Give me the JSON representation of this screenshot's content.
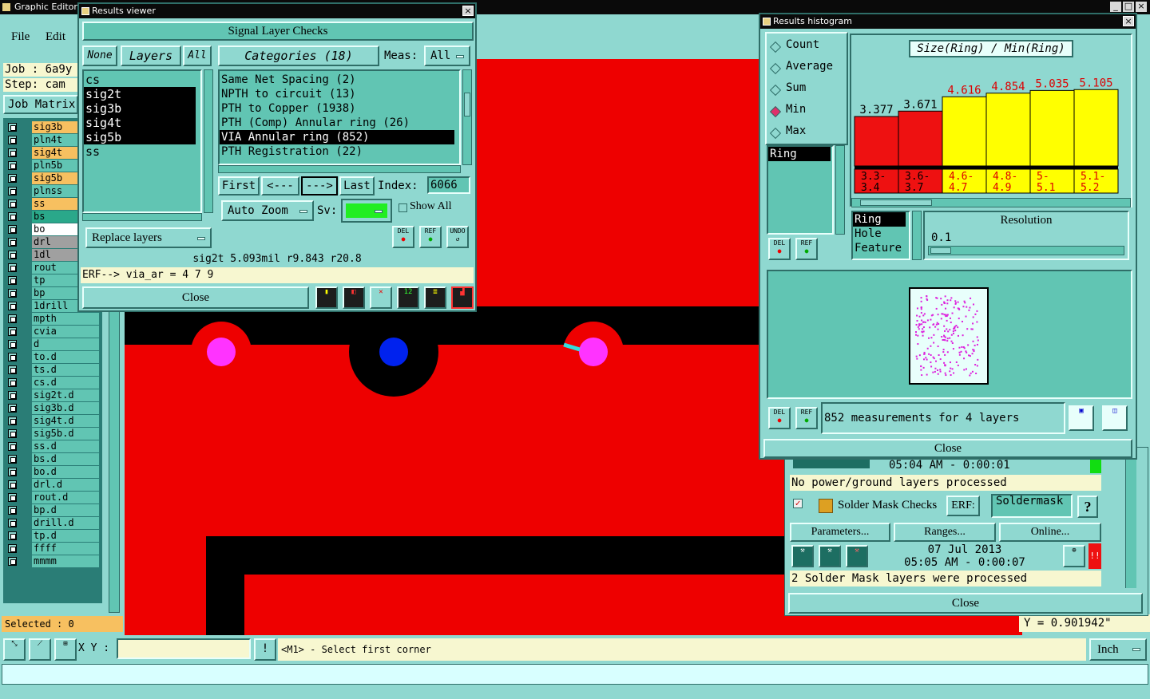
{
  "main": {
    "title": "Graphic Editor",
    "menu": [
      "File",
      "Edit"
    ],
    "job_label": "Job : 6a9y",
    "step_label": "Step: cam",
    "job_matrix": "Job Matrix",
    "selected": "Selected : 0",
    "xy_label": "X Y :",
    "status_msg": "<M1> - Select first corner",
    "units": "Inch",
    "y_readout": "Y = 0.901942\"",
    "bang": "!"
  },
  "layers": [
    {
      "name": "sig3b",
      "color": "#f7c060"
    },
    {
      "name": "pln4t",
      "color": "#61c5b3"
    },
    {
      "name": "sig4t",
      "color": "#f7c060"
    },
    {
      "name": "pln5b",
      "color": "#61c5b3"
    },
    {
      "name": "sig5b",
      "color": "#f7c060"
    },
    {
      "name": "plnss",
      "color": "#61c5b3"
    },
    {
      "name": "ss",
      "color": "#f7c060"
    },
    {
      "name": "bs",
      "color": "#2aa88a"
    },
    {
      "name": "bo",
      "color": "#ffffff"
    },
    {
      "name": "drl",
      "color": "#a0a0a0"
    },
    {
      "name": "1dl",
      "color": "#a0a0a0"
    },
    {
      "name": "rout",
      "color": "#61c5b3"
    },
    {
      "name": "tp",
      "color": "#61c5b3"
    },
    {
      "name": "bp",
      "color": "#61c5b3"
    },
    {
      "name": "1drill",
      "color": "#61c5b3"
    },
    {
      "name": "mpth",
      "color": "#61c5b3"
    },
    {
      "name": "cvia",
      "color": "#61c5b3"
    },
    {
      "name": "d",
      "color": "#61c5b3"
    },
    {
      "name": "to.d",
      "color": "#61c5b3"
    },
    {
      "name": "ts.d",
      "color": "#61c5b3"
    },
    {
      "name": "cs.d",
      "color": "#61c5b3"
    },
    {
      "name": "sig2t.d",
      "color": "#61c5b3"
    },
    {
      "name": "sig3b.d",
      "color": "#61c5b3"
    },
    {
      "name": "sig4t.d",
      "color": "#61c5b3"
    },
    {
      "name": "sig5b.d",
      "color": "#61c5b3"
    },
    {
      "name": "ss.d",
      "color": "#61c5b3"
    },
    {
      "name": "bs.d",
      "color": "#61c5b3"
    },
    {
      "name": "bo.d",
      "color": "#61c5b3"
    },
    {
      "name": "drl.d",
      "color": "#61c5b3"
    },
    {
      "name": "rout.d",
      "color": "#61c5b3"
    },
    {
      "name": "bp.d",
      "color": "#61c5b3"
    },
    {
      "name": "drill.d",
      "color": "#61c5b3"
    },
    {
      "name": "tp.d",
      "color": "#61c5b3"
    },
    {
      "name": "ffff",
      "color": "#61c5b3"
    },
    {
      "name": "mmmm",
      "color": "#61c5b3"
    }
  ],
  "viewer": {
    "title": "Results viewer",
    "header": "Signal Layer Checks",
    "btn_none": "None",
    "btn_layers": "Layers",
    "btn_all": "All",
    "layer_list": [
      "cs",
      "sig2t",
      "sig3b",
      "sig4t",
      "sig5b",
      "ss"
    ],
    "categories_label": "Categories (18)",
    "meas_label": "Meas:",
    "meas_value": "All",
    "categories": [
      "Same Net Spacing (2)",
      "NPTH to circuit (13)",
      "PTH to Copper (1938)",
      "PTH (Comp) Annular ring (26)",
      "VIA Annular ring (852)",
      "PTH Registration (22)"
    ],
    "first": "First",
    "prev": "<---",
    "next": "--->",
    "last": "Last",
    "index_label": "Index:",
    "index_value": "6066",
    "auto_zoom": "Auto Zoom",
    "sv_label": "Sv:",
    "show_all": "Show All",
    "replace_layers": "Replace layers",
    "del": "DEL",
    "ref": "REF",
    "undo": "UNDO",
    "status": "sig2t 5.093mil r9.843 r20.8",
    "erf": "ERF--> via_ar = 4 7 9",
    "close": "Close"
  },
  "histogram": {
    "title": "Results histogram",
    "radio": [
      "Count",
      "Average",
      "Sum",
      "Min",
      "Max"
    ],
    "radio_selected": "Min",
    "chart_title": "Size(Ring) / Min(Ring)",
    "list": [
      "Ring"
    ],
    "types": [
      "Ring",
      "Hole",
      "Feature"
    ],
    "resolution_label": "Resolution",
    "resolution_value": "0.1",
    "del": "DEL",
    "ref": "REF",
    "measurements": "852 measurements for 4 layers",
    "close": "Close"
  },
  "chart_data": {
    "type": "bar",
    "title": "Size(Ring) / Min(Ring)",
    "categories": [
      "3.3-3.4",
      "3.6-3.7",
      "4.6-4.7",
      "4.8-4.9",
      "5-5.1",
      "5.1-5.2"
    ],
    "values": [
      3.377,
      3.671,
      4.616,
      4.854,
      5.035,
      5.105
    ],
    "labels": [
      "3.377",
      "3.671",
      "4.616",
      "4.854",
      "5.035",
      "5.105"
    ],
    "bin_labels": [
      [
        "3.3-",
        "3.4"
      ],
      [
        "3.6-",
        "3.7"
      ],
      [
        "4.6-",
        "4.7"
      ],
      [
        "4.8-",
        "4.9"
      ],
      [
        "5-",
        "5.1"
      ],
      [
        "5.1-",
        "5.2"
      ]
    ],
    "colors": [
      "#ee1111",
      "#ee1111",
      "#ffff00",
      "#ffff00",
      "#ffff00",
      "#ffff00"
    ],
    "label_colors": [
      "#000000",
      "#000000",
      "#dd0000",
      "#dd0000",
      "#dd0000",
      "#dd0000"
    ],
    "bar_heights": [
      0.48,
      0.54,
      0.7,
      0.74,
      0.77,
      0.78
    ]
  },
  "checks": {
    "time1": "05:04 AM - 0:00:01",
    "msg1": "No power/ground layers processed",
    "solder_label": "Solder Mask Checks",
    "erf_label": "ERF:",
    "erf_value": "Soldermask",
    "help": "?",
    "parameters": "Parameters...",
    "ranges": "Ranges...",
    "online": "Online...",
    "date": "07 Jul 2013",
    "time2": "05:05 AM - 0:00:07",
    "msg2": "2 Solder Mask layers were processed",
    "close": "Close",
    "bang": "!!"
  }
}
